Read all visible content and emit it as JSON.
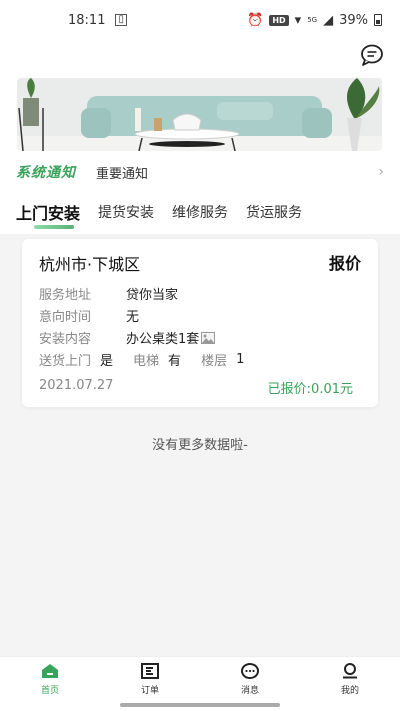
{
  "status_bar": {
    "time": "18:11",
    "hd": "HD",
    "network": "5G",
    "battery": "39%"
  },
  "header": {
    "message_icon": "chat-bubble-icon"
  },
  "notice": {
    "logo": "系统通知",
    "text": "重要通知",
    "arrow": "›"
  },
  "tabs": [
    {
      "label": "上门安装",
      "active": true
    },
    {
      "label": "提货安装",
      "active": false
    },
    {
      "label": "维修服务",
      "active": false
    },
    {
      "label": "货运服务",
      "active": false
    }
  ],
  "order": {
    "location": "杭州市·下城区",
    "quote_label": "报价",
    "service_address_label": "服务地址",
    "service_address": "贷你当家",
    "intended_time_label": "意向时间",
    "intended_time": "无",
    "install_content_label": "安装内容",
    "install_content": "办公桌类1套",
    "delivery_label": "送货上门",
    "delivery_value": "是",
    "elevator_label": "电梯",
    "elevator_value": "有",
    "floor_label": "楼层",
    "floor_value": "1",
    "date": "2021.07.27",
    "status": "已报价:0.01元"
  },
  "list_footer": "没有更多数据啦-",
  "bottom_nav": [
    {
      "label": "首页",
      "icon": "home-icon",
      "active": true
    },
    {
      "label": "订单",
      "icon": "order-icon",
      "active": false
    },
    {
      "label": "消息",
      "icon": "message-icon",
      "active": false
    },
    {
      "label": "我的",
      "icon": "profile-icon",
      "active": false
    }
  ],
  "colors": {
    "accent": "#3aa35b",
    "background": "#f4f4f4"
  }
}
